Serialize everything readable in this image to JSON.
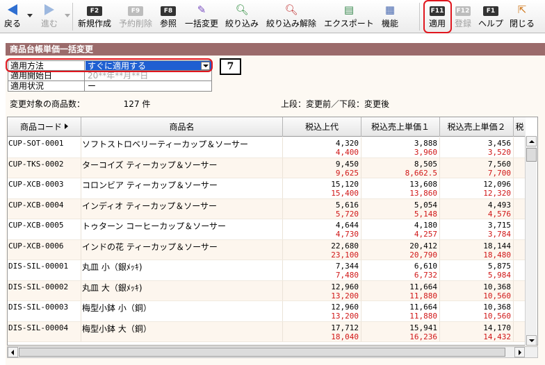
{
  "toolbar": {
    "back": {
      "label": "戻る",
      "icon": "back-arrow-icon"
    },
    "forward": {
      "label": "進む",
      "icon": "forward-arrow-icon"
    },
    "new": {
      "key": "F2",
      "label": "新規作成"
    },
    "reserve_delete": {
      "key": "F9",
      "label": "予約削除"
    },
    "reference": {
      "key": "F8",
      "label": "参照"
    },
    "bulk_change": {
      "label": "一括変更",
      "icon": "wand-icon"
    },
    "filter": {
      "label": "絞り込み",
      "icon": "magnifier-icon"
    },
    "filter_clear": {
      "label": "絞り込み解除",
      "icon": "magnifier-clear-icon"
    },
    "export": {
      "label": "エクスポート",
      "icon": "export-icon"
    },
    "function": {
      "label": "機能",
      "icon": "function-icon"
    },
    "apply": {
      "key": "F11",
      "label": "適用"
    },
    "register": {
      "key": "F12",
      "label": "登録"
    },
    "help": {
      "key": "F1",
      "label": "ヘルプ"
    },
    "close": {
      "label": "閉じる",
      "icon": "close-door-icon"
    }
  },
  "title": "商品台帳単価一括変更",
  "form": {
    "method_label": "適用方法",
    "method_value": "すぐに適用する",
    "start_label": "適用開始日",
    "start_placeholder": "20**年**月**日",
    "status_label": "適用状況",
    "status_value": "ー"
  },
  "callout": "7",
  "count": {
    "label": "変更対象の商品数：",
    "value": "127",
    "unit": "件"
  },
  "legend": "上段：変更前／下段：変更後",
  "table": {
    "headers": {
      "code": "商品コード",
      "name": "商品名",
      "c1": "税込上代",
      "c2": "税込売上単価１",
      "c3": "税込売上単価２",
      "c4": "税"
    },
    "rows": [
      {
        "code": "CUP-SOT-0001",
        "name": "ソフトストロベリーティーカップ＆ソーサー",
        "v1": [
          "4,320",
          "4,400"
        ],
        "v2": [
          "3,888",
          "3,960"
        ],
        "v3": [
          "3,456",
          "3,520"
        ]
      },
      {
        "code": "CUP-TKS-0002",
        "name": "ターコイズ ティーカップ＆ソーサー",
        "v1": [
          "9,450",
          "9,625"
        ],
        "v2": [
          "8,505",
          "8,662.5"
        ],
        "v3": [
          "7,560",
          "7,700"
        ]
      },
      {
        "code": "CUP-XCB-0003",
        "name": "コロンビア ティーカップ＆ソーサー",
        "v1": [
          "15,120",
          "15,400"
        ],
        "v2": [
          "13,608",
          "13,860"
        ],
        "v3": [
          "12,096",
          "12,320"
        ]
      },
      {
        "code": "CUP-XCB-0004",
        "name": "インディオ ティーカップ＆ソーサー",
        "v1": [
          "5,616",
          "5,720"
        ],
        "v2": [
          "5,054",
          "5,148"
        ],
        "v3": [
          "4,493",
          "4,576"
        ]
      },
      {
        "code": "CUP-XCB-0005",
        "name": "トゥターン コーヒーカップ＆ソーサー",
        "v1": [
          "4,644",
          "4,730"
        ],
        "v2": [
          "4,180",
          "4,257"
        ],
        "v3": [
          "3,715",
          "3,784"
        ]
      },
      {
        "code": "CUP-XCB-0006",
        "name": "インドの花 ティーカップ＆ソーサー",
        "v1": [
          "22,680",
          "23,100"
        ],
        "v2": [
          "20,412",
          "20,790"
        ],
        "v3": [
          "18,144",
          "18,480"
        ]
      },
      {
        "code": "DIS-SIL-00001",
        "name": "丸皿 小（銀ﾒｯｷ)",
        "v1": [
          "7,344",
          "7,480"
        ],
        "v2": [
          "6,610",
          "6,732"
        ],
        "v3": [
          "5,875",
          "5,984"
        ]
      },
      {
        "code": "DIS-SIL-00002",
        "name": "丸皿 大（銀ﾒｯｷ)",
        "v1": [
          "12,960",
          "13,200"
        ],
        "v2": [
          "11,664",
          "11,880"
        ],
        "v3": [
          "10,368",
          "10,560"
        ]
      },
      {
        "code": "DIS-SIL-00003",
        "name": "梅型小鉢 小（銅）",
        "v1": [
          "12,960",
          "13,200"
        ],
        "v2": [
          "11,664",
          "11,880"
        ],
        "v3": [
          "10,368",
          "10,560"
        ]
      },
      {
        "code": "DIS-SIL-00004",
        "name": "梅型小鉢 大（銅）",
        "v1": [
          "17,712",
          "18,040"
        ],
        "v2": [
          "15,941",
          "16,236"
        ],
        "v3": [
          "14,170",
          "14,432"
        ]
      }
    ]
  },
  "colors": {
    "title_bar": "#9b6b6b",
    "highlight": "#e0161e",
    "after_value": "#d01616",
    "selection": "#1f5fd1"
  }
}
